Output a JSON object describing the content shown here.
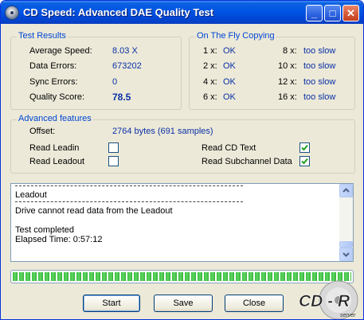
{
  "window": {
    "title": "CD Speed: Advanced DAE Quality Test"
  },
  "title_buttons": {
    "minimize": "_",
    "maximize": "□",
    "close": "✕"
  },
  "test_results": {
    "group_title": "Test Results",
    "rows": [
      {
        "label": "Average Speed:",
        "value": "8.03 X"
      },
      {
        "label": "Data Errors:",
        "value": "673202"
      },
      {
        "label": "Sync Errors:",
        "value": "0"
      },
      {
        "label": "Quality Score:",
        "value": "78.5"
      }
    ]
  },
  "on_the_fly": {
    "group_title": "On The Fly Copying",
    "rows": [
      {
        "left_speed": "1 x:",
        "left_status": "OK",
        "right_speed": "8 x:",
        "right_status": "too slow"
      },
      {
        "left_speed": "2 x:",
        "left_status": "OK",
        "right_speed": "10 x:",
        "right_status": "too slow"
      },
      {
        "left_speed": "4 x:",
        "left_status": "OK",
        "right_speed": "12 x:",
        "right_status": "too slow"
      },
      {
        "left_speed": "6 x:",
        "left_status": "OK",
        "right_speed": "16 x:",
        "right_status": "too slow"
      }
    ]
  },
  "advanced": {
    "group_title": "Advanced features",
    "offset_label": "Offset:",
    "offset_value": "2764 bytes (691 samples)",
    "read_leadin": {
      "label": "Read Leadin",
      "checked": false
    },
    "read_leadout": {
      "label": "Read Leadout",
      "checked": false
    },
    "read_cd_text": {
      "label": "Read CD Text",
      "checked": true
    },
    "read_subchannel": {
      "label": "Read Subchannel Data",
      "checked": true
    }
  },
  "log": {
    "lines": [
      {
        "type": "sep"
      },
      {
        "type": "text",
        "text": "Leadout"
      },
      {
        "type": "sep"
      },
      {
        "type": "text",
        "text": "Drive cannot read data from the Leadout"
      },
      {
        "type": "blank"
      },
      {
        "type": "text",
        "text": "Test completed"
      },
      {
        "type": "text",
        "text": "Elapsed Time:  0:57:12"
      }
    ]
  },
  "progress": {
    "fraction": 1.0
  },
  "buttons": {
    "start": "Start",
    "save": "Save",
    "close": "Close"
  },
  "logo": {
    "text": "CD - R",
    "subtext": "server"
  }
}
